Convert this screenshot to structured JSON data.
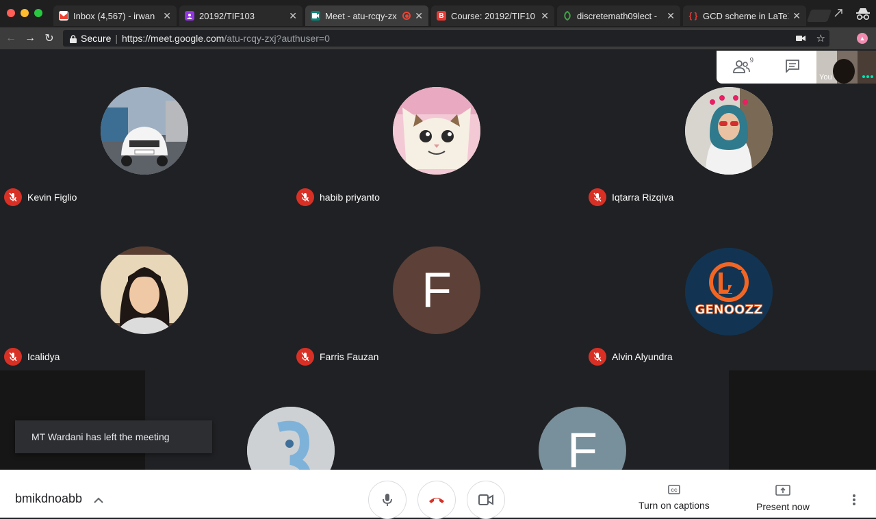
{
  "browser": {
    "tabs": [
      {
        "title": "Inbox (4,567) - irwan",
        "favicon": "gmail-icon",
        "color": "#ea4335"
      },
      {
        "title": "20192/TIF103",
        "favicon": "classroom-icon",
        "color": "#9334e6"
      },
      {
        "title": "Meet - atu-rcqy-zx",
        "favicon": "meet-icon",
        "color": "#00897b",
        "recording": true
      },
      {
        "title": "Course: 20192/TIF10",
        "favicon": "moodle-icon",
        "color": "#e53935"
      },
      {
        "title": "discretemath09lect -",
        "favicon": "leaf-icon",
        "color": "#43a047"
      },
      {
        "title": "GCD scheme in LaTeX",
        "favicon": "overleaf-icon",
        "color": "#e53935"
      }
    ],
    "secure_label": "Secure",
    "url_host": "https://meet.google.com",
    "url_path": "/atu-rcqy-zxj?authuser=0"
  },
  "participants": [
    {
      "name": "Kevin Figlio",
      "avatar": "car-photo"
    },
    {
      "name": "habib priyanto",
      "avatar": "cat-photo"
    },
    {
      "name": "Iqtarra Rizqiva",
      "avatar": "person-photo"
    },
    {
      "name": "Icalidya",
      "avatar": "person-photo"
    },
    {
      "name": "Farris Fauzan",
      "avatar": "letter",
      "letter": "F",
      "color": "#5d4037"
    },
    {
      "name": "Alvin Alyundra",
      "avatar": "genoozz-logo",
      "logo_text": "GENOOZZ"
    },
    {
      "name": "",
      "avatar": "abstract-logo"
    },
    {
      "name": "",
      "avatar": "letter",
      "letter": "F",
      "color": "#78909c"
    }
  ],
  "people_count": "9",
  "self_label": "You",
  "toast": "MT Wardani has left the meeting",
  "bottom": {
    "meeting_code": "bmikdnoabb",
    "captions_label": "Turn on captions",
    "present_label": "Present now"
  }
}
